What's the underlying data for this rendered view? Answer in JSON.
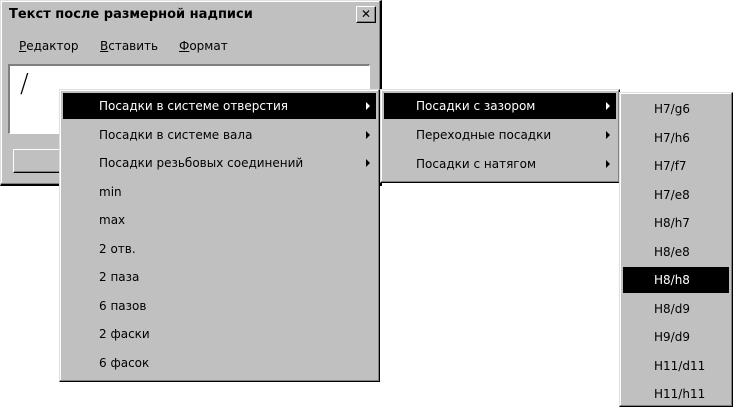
{
  "window": {
    "title": "Текст после размерной надписи",
    "close_glyph": "✕",
    "menus": [
      "Редактор",
      "Вставить",
      "Формат"
    ],
    "edit_text": "/"
  },
  "menu1": {
    "items": [
      {
        "label": "Посадки в системе отверстия",
        "submenu": true,
        "selected": true
      },
      {
        "label": "Посадки в системе вала",
        "submenu": true
      },
      {
        "label": "Посадки резьбовых соединений",
        "submenu": true
      },
      {
        "label": "min"
      },
      {
        "label": "max"
      },
      {
        "label": "2 отв."
      },
      {
        "label": "2 паза"
      },
      {
        "label": "6 пазов"
      },
      {
        "label": "2 фаски"
      },
      {
        "label": "6 фасок"
      }
    ]
  },
  "menu2": {
    "items": [
      {
        "label": "Посадки с зазором",
        "submenu": true,
        "selected": true
      },
      {
        "label": "Переходные посадки",
        "submenu": true
      },
      {
        "label": "Посадки с натягом",
        "submenu": true
      }
    ]
  },
  "menu3": {
    "items": [
      {
        "label": "H7/g6"
      },
      {
        "label": "H7/h6"
      },
      {
        "label": "H7/f7"
      },
      {
        "label": "H7/e8"
      },
      {
        "label": "H8/h7"
      },
      {
        "label": "H8/e8"
      },
      {
        "label": "H8/h8",
        "selected": true
      },
      {
        "label": "H8/d9"
      },
      {
        "label": "H9/d9"
      },
      {
        "label": "H11/d11"
      },
      {
        "label": "H11/h11"
      }
    ]
  }
}
